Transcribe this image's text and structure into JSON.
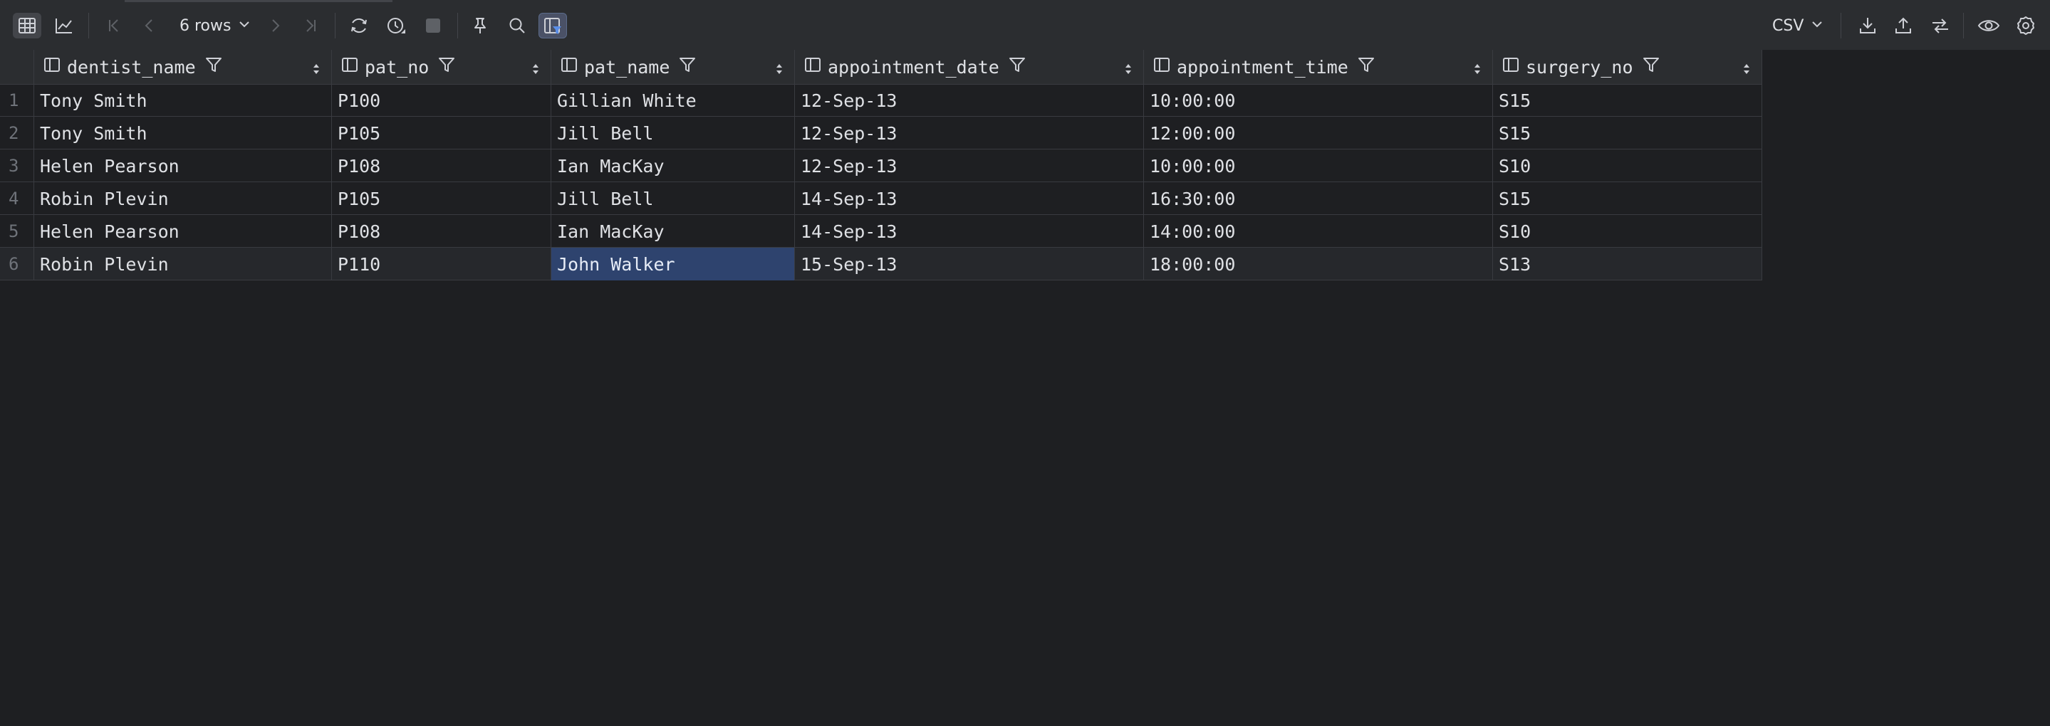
{
  "toolbar": {
    "rows_label": "6 rows",
    "format_label": "CSV",
    "icons": [
      "table-view-icon",
      "chart-view-icon",
      "first-page-icon",
      "previous-page-icon",
      "next-page-icon",
      "last-page-icon",
      "reload-icon",
      "history-icon",
      "stop-icon",
      "pin-icon",
      "search-icon",
      "filter-panel-icon",
      "download-icon",
      "upload-icon",
      "compare-icon",
      "view-icon",
      "settings-icon"
    ]
  },
  "table": {
    "columns": [
      {
        "name": "dentist_name"
      },
      {
        "name": "pat_no"
      },
      {
        "name": "pat_name"
      },
      {
        "name": "appointment_date"
      },
      {
        "name": "appointment_time"
      },
      {
        "name": "surgery_no"
      }
    ],
    "rows": [
      {
        "num": "1",
        "cells": [
          "Tony Smith",
          "P100",
          "Gillian White",
          "12-Sep-13",
          "10:00:00",
          "S15"
        ]
      },
      {
        "num": "2",
        "cells": [
          "Tony Smith",
          "P105",
          "Jill Bell",
          "12-Sep-13",
          "12:00:00",
          "S15"
        ]
      },
      {
        "num": "3",
        "cells": [
          "Helen Pearson",
          "P108",
          "Ian MacKay",
          "12-Sep-13",
          "10:00:00",
          "S10"
        ]
      },
      {
        "num": "4",
        "cells": [
          "Robin Plevin",
          "P105",
          "Jill Bell",
          "14-Sep-13",
          "16:30:00",
          "S15"
        ]
      },
      {
        "num": "5",
        "cells": [
          "Helen Pearson",
          "P108",
          "Ian MacKay",
          "14-Sep-13",
          "14:00:00",
          "S10"
        ]
      },
      {
        "num": "6",
        "cells": [
          "Robin Plevin",
          "P110",
          "John Walker",
          "15-Sep-13",
          "18:00:00",
          "S13"
        ]
      }
    ],
    "selected_cell": {
      "row": 5,
      "col": 2
    },
    "colors": {
      "selection": "#2e436e",
      "header_bg": "#2b2d30",
      "grid_bg": "#1e1f22"
    }
  }
}
